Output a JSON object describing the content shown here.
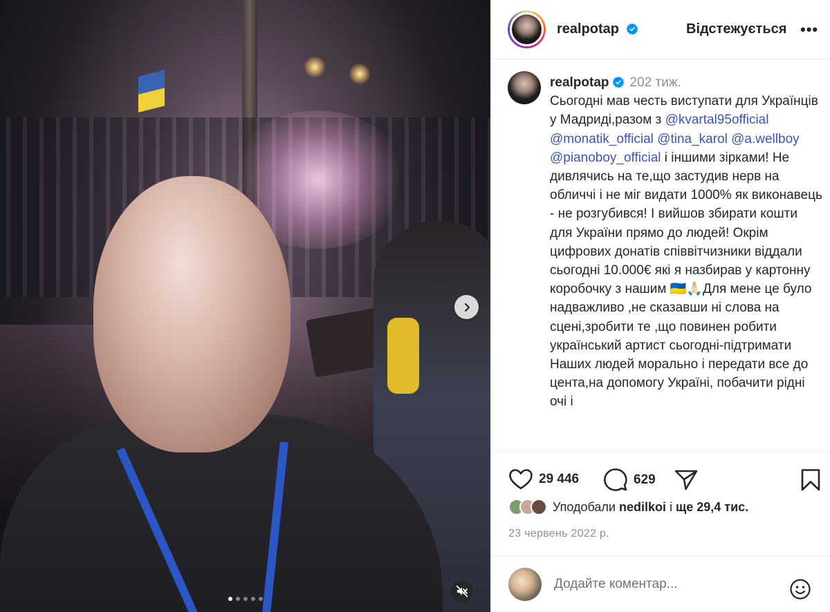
{
  "post": {
    "username": "realpotap",
    "verified": true,
    "follow_state": "Відстежується",
    "more_label": "•••"
  },
  "caption": {
    "username": "realpotap",
    "age": "202 тиж.",
    "text_1": "Сьогодні мав честь виступати для Українців у Мадриді,разом з ",
    "mentions": [
      "@kvartal95official",
      "@monatik_official",
      "@tina_karol",
      "@a.wellboy",
      "@pianoboy_official"
    ],
    "text_2": " і іншими зірками! Не дивлячись на те,що застудив нерв на обличчі і не міг видати 1000% як виконавець - не розгубився! І вийшов збирати кошти для України прямо до людей! Окрім цифрових донатів співвітчизники віддали сьогодні 10.000€ які я назбирав у картонну коробочку з нашим 🇺🇦🙏🏻Для мене це було надважливо ,не сказавши ні слова на сцені,зробити те ,що повинен робити український артист сьогодні-підтримати Наших людей морально і передати все до цента,на допомогу Україні, побачити рідні очі і"
  },
  "stats": {
    "likes": "29 446",
    "comments": "629"
  },
  "liked_by": {
    "prefix": "Уподобали",
    "user": "nedilkoi",
    "middle": "і",
    "count": "ще 29,4 тис."
  },
  "date": "23 червень 2022 р.",
  "comment_box": {
    "placeholder": "Додайте коментар..."
  },
  "carousel": {
    "slide_count": 5,
    "active_index": 0
  },
  "icons": {
    "verified": "verified-badge-icon",
    "next": "chevron-right-icon",
    "mute": "speaker-muted-icon",
    "like": "heart-icon",
    "comment": "speech-bubble-icon",
    "share": "paper-plane-icon",
    "save": "bookmark-icon",
    "emoji": "smiley-icon",
    "more": "more-options-icon"
  },
  "colors": {
    "verified_blue": "#0095f6",
    "mention_link": "#3d55b8",
    "muted_text": "#8e8e8e",
    "divider": "#efefef"
  }
}
